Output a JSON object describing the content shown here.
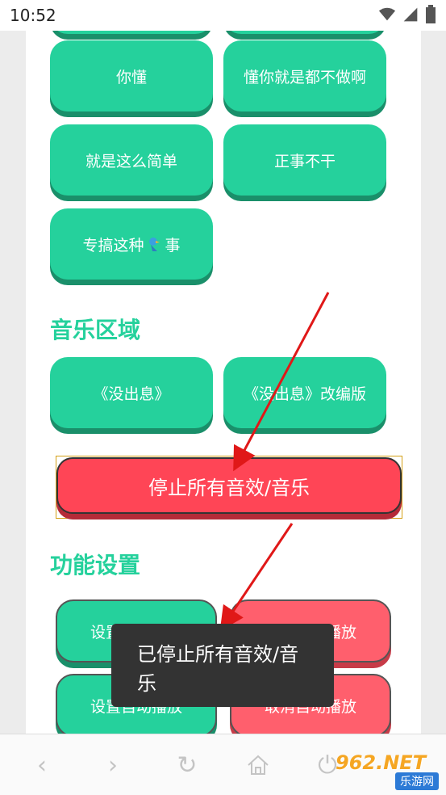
{
  "status_bar": {
    "time": "10:52"
  },
  "soundboard": {
    "row1": [
      "你懂",
      "懂你就是都不做啊"
    ],
    "row2": [
      "就是这么简单",
      "正事不干"
    ],
    "row3_prefix": "专搞这种",
    "row3_suffix": "事"
  },
  "music_section": {
    "heading": "音乐区域",
    "buttons": [
      "《没出息》",
      "《没出息》改编版"
    ],
    "stop_label": "停止所有音效/音乐"
  },
  "settings_section": {
    "heading": "功能设置",
    "left_buttons": [
      "设置循环播放",
      "设置自动播放"
    ],
    "right_buttons": [
      "取消循环播放",
      "取消自动播放"
    ]
  },
  "toast": {
    "message": "已停止所有音效/音乐"
  },
  "watermark": {
    "brand": "962.NET",
    "site": "乐游网"
  },
  "colors": {
    "accent_green": "#25d19c",
    "stop_red": "#ff4556",
    "arrow_red": "#e01818"
  }
}
